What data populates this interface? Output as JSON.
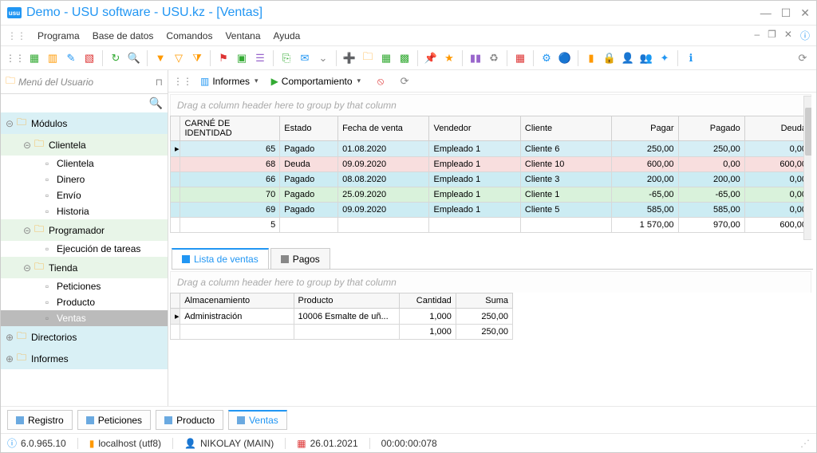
{
  "window": {
    "logo_text": "usu",
    "title": "Demo - USU software - USU.kz - [Ventas]"
  },
  "menubar": {
    "items": [
      "Programa",
      "Base de datos",
      "Comandos",
      "Ventana",
      "Ayuda"
    ]
  },
  "subbar": {
    "informes": "Informes",
    "comportamiento": "Comportamiento"
  },
  "leftpanel": {
    "title": "Menú del Usuario",
    "tree": {
      "modulos": "Módulos",
      "clientela": "Clientela",
      "clientela_items": [
        "Clientela",
        "Dinero",
        "Envío",
        "Historia"
      ],
      "programador": "Programador",
      "programador_items": [
        "Ejecución de tareas"
      ],
      "tienda": "Tienda",
      "tienda_items": [
        "Peticiones",
        "Producto",
        "Ventas"
      ],
      "directorios": "Directorios",
      "informes": "Informes"
    }
  },
  "grid1": {
    "group_hint": "Drag a column header here to group by that column",
    "headers": [
      "CARNÉ DE IDENTIDAD",
      "Estado",
      "Fecha de venta",
      "Vendedor",
      "Cliente",
      "Pagar",
      "Pagado",
      "Deuda"
    ],
    "rows": [
      {
        "cls": "row-blue",
        "id": "65",
        "estado": "Pagado",
        "fecha": "01.08.2020",
        "vend": "Empleado 1",
        "cli": "Cliente 6",
        "pagar": "250,00",
        "pagado": "250,00",
        "deuda": "0,00"
      },
      {
        "cls": "row-pink",
        "id": "68",
        "estado": "Deuda",
        "fecha": "09.09.2020",
        "vend": "Empleado 1",
        "cli": "Cliente 10",
        "pagar": "600,00",
        "pagado": "0,00",
        "deuda": "600,00"
      },
      {
        "cls": "row-cyan",
        "id": "66",
        "estado": "Pagado",
        "fecha": "08.08.2020",
        "vend": "Empleado 1",
        "cli": "Cliente 3",
        "pagar": "200,00",
        "pagado": "200,00",
        "deuda": "0,00"
      },
      {
        "cls": "row-green",
        "id": "70",
        "estado": "Pagado",
        "fecha": "25.09.2020",
        "vend": "Empleado 1",
        "cli": "Cliente 1",
        "pagar": "-65,00",
        "pagado": "-65,00",
        "deuda": "0,00"
      },
      {
        "cls": "row-cyan",
        "id": "69",
        "estado": "Pagado",
        "fecha": "09.09.2020",
        "vend": "Empleado 1",
        "cli": "Cliente 5",
        "pagar": "585,00",
        "pagado": "585,00",
        "deuda": "0,00"
      }
    ],
    "footer": {
      "count": "5",
      "pagar": "1 570,00",
      "pagado": "970,00",
      "deuda": "600,00"
    }
  },
  "detail_tabs": {
    "lista": "Lista de ventas",
    "pagos": "Pagos"
  },
  "grid2": {
    "group_hint": "Drag a column header here to group by that column",
    "headers": [
      "Almacenamiento",
      "Producto",
      "Cantidad",
      "Suma"
    ],
    "rows": [
      {
        "alm": "Administración",
        "prod": "10006 Esmalte de uñ...",
        "cant": "1,000",
        "suma": "250,00"
      }
    ],
    "footer": {
      "cant": "1,000",
      "suma": "250,00"
    }
  },
  "docs_tabs": [
    "Registro",
    "Peticiones",
    "Producto",
    "Ventas"
  ],
  "statusbar": {
    "version": "6.0.965.10",
    "host": "localhost (utf8)",
    "user": "NIKOLAY (MAIN)",
    "date": "26.01.2021",
    "time": "00:00:00:078"
  }
}
